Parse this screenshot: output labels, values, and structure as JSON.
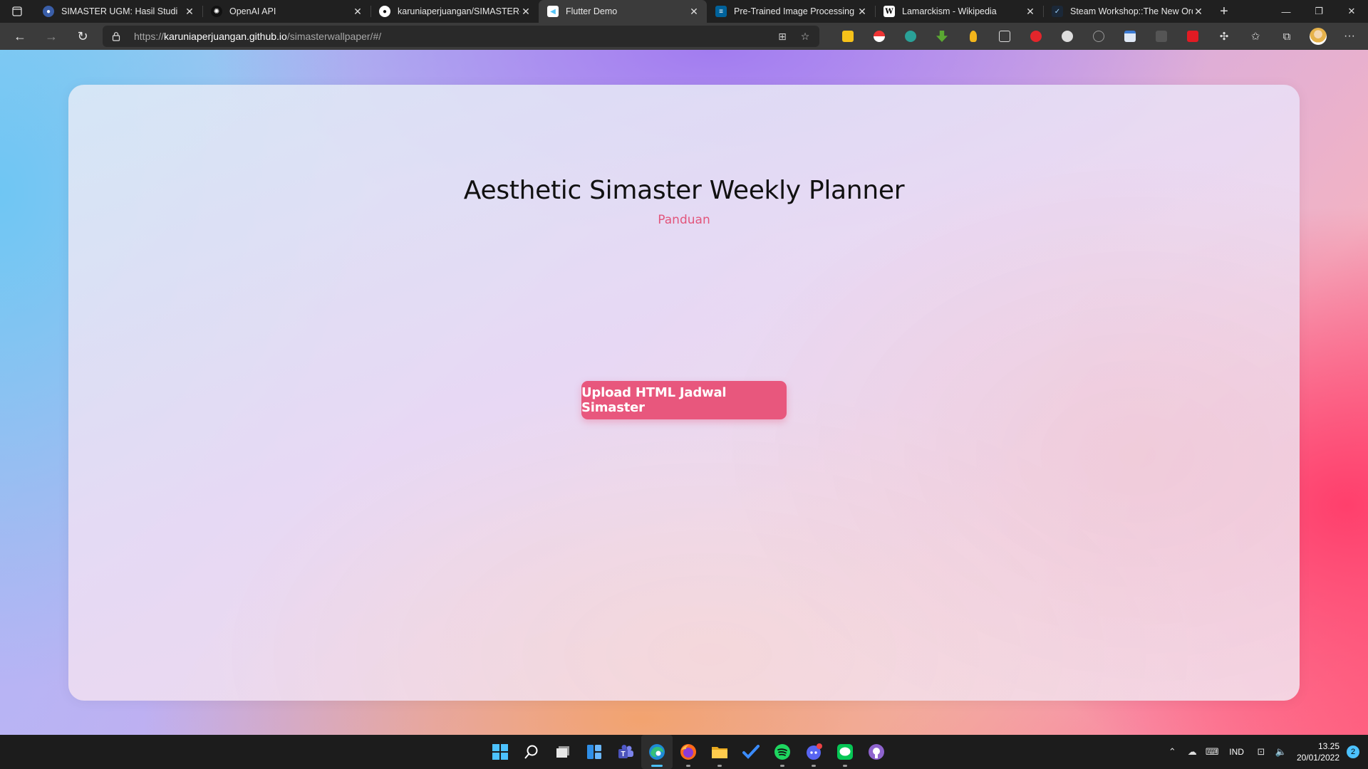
{
  "browser": {
    "tabs": [
      {
        "title": "SIMASTER UGM: Hasil Studi",
        "icon": "simaster-favicon",
        "color": "#3a5ea8",
        "active": false
      },
      {
        "title": "OpenAI API",
        "icon": "openai-favicon",
        "color": "#000000",
        "active": false
      },
      {
        "title": "karuniaperjuangan/SIMASTER-W",
        "icon": "github-favicon",
        "color": "#ffffff",
        "active": false
      },
      {
        "title": "Flutter Demo",
        "icon": "flutter-favicon",
        "color": "#54c5f8",
        "active": true
      },
      {
        "title": "Pre-Trained Image Processing Tr",
        "icon": "ieee-favicon",
        "color": "#00629b",
        "active": false
      },
      {
        "title": "Lamarckism - Wikipedia",
        "icon": "wikipedia-favicon",
        "color": "#ffffff",
        "active": false
      },
      {
        "title": "Steam Workshop::The New Orde",
        "icon": "steam-favicon",
        "color": "#1b2838",
        "active": false
      }
    ],
    "url": {
      "protocol": "https://",
      "host": "karuniaperjuangan.github.io",
      "path": "/simasterwallpaper/#/"
    }
  },
  "page": {
    "title": "Aesthetic Simaster Weekly Planner",
    "guide_link": "Panduan",
    "upload_button": "Upload HTML Jadwal Simaster",
    "accent_color": "#e8577d"
  },
  "taskbar": {
    "apps": [
      "windows-start",
      "search",
      "task-view",
      "widgets",
      "teams",
      "edge",
      "firefox",
      "file-explorer",
      "todo",
      "spotify",
      "discord",
      "line",
      "github-desktop"
    ],
    "language": "IND",
    "time": "13.25",
    "date": "20/01/2022",
    "notifications": "2"
  }
}
